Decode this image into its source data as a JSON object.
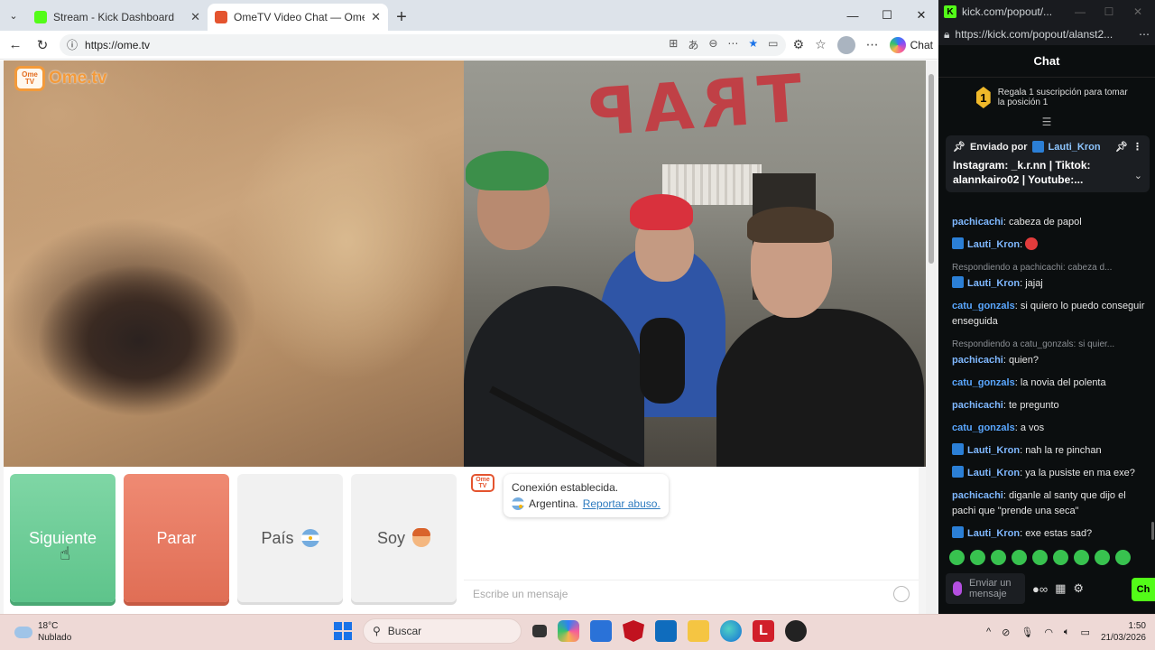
{
  "browser": {
    "tabs": [
      {
        "title": "Stream - Kick Dashboard",
        "icon": "kick-icon",
        "active": false
      },
      {
        "title": "OmeTV Video Chat — Omeg",
        "icon": "ometv-icon",
        "active": true
      }
    ],
    "url": "https://ome.tv",
    "copilot_label": "Chat"
  },
  "ometv": {
    "logo_text": "Ome.tv",
    "logo_badge": "Ome TV",
    "remote_graffiti": "TRAP",
    "buttons": {
      "next": "Siguiente",
      "stop": "Parar",
      "country": "País",
      "me": "Soy"
    },
    "system_message": {
      "line1": "Conexión establecida.",
      "country": "Argentina.",
      "report": "Reportar abuso."
    },
    "input_placeholder": "Escribe un mensaje"
  },
  "kick": {
    "window_title": "kick.com/popout/...",
    "url": "https://kick.com/popout/alanst2...",
    "header": "Chat",
    "gift": {
      "rank": "1",
      "text": "Regala 1 suscripción para tomar la posición 1"
    },
    "pinned": {
      "label": "Enviado por",
      "user": "Lauti_Kron",
      "text": "Instagram: _k.r.nn | Tiktok: alannkairo02 | Youtube:..."
    },
    "messages": [
      {
        "user": "pachicachi",
        "color": "#7fb8ff",
        "text": "cabeza de papol",
        "badge": false,
        "reply": ""
      },
      {
        "user": "Lauti_Kron",
        "color": "#7fb8ff",
        "text": "",
        "badge": true,
        "reply": "",
        "emote": true
      },
      {
        "user": "Lauti_Kron",
        "color": "#7fb8ff",
        "text": "jajaj",
        "badge": true,
        "reply": "Respondiendo a pachicachi: cabeza d..."
      },
      {
        "user": "catu_gonzals",
        "color": "#5aa7ff",
        "text": "si quiero lo puedo conseguir enseguida",
        "badge": false,
        "reply": ""
      },
      {
        "user": "pachicachi",
        "color": "#7fb8ff",
        "text": "quien?",
        "badge": false,
        "reply": "Respondiendo a catu_gonzals: si quier..."
      },
      {
        "user": "catu_gonzals",
        "color": "#5aa7ff",
        "text": "la novia del polenta",
        "badge": false,
        "reply": ""
      },
      {
        "user": "pachicachi",
        "color": "#7fb8ff",
        "text": "te pregunto",
        "badge": false,
        "reply": ""
      },
      {
        "user": "catu_gonzals",
        "color": "#5aa7ff",
        "text": "a vos",
        "badge": false,
        "reply": ""
      },
      {
        "user": "Lauti_Kron",
        "color": "#7fb8ff",
        "text": "nah la re pinchan",
        "badge": true,
        "reply": ""
      },
      {
        "user": "Lauti_Kron",
        "color": "#7fb8ff",
        "text": "ya la pusiste en ma exe?",
        "badge": true,
        "reply": ""
      },
      {
        "user": "pachicachi",
        "color": "#7fb8ff",
        "text": "diganle al santy que dijo el pachi que \"prende una seca\"",
        "badge": false,
        "reply": ""
      },
      {
        "user": "Lauti_Kron",
        "color": "#7fb8ff",
        "text": "exe estas sad?",
        "badge": true,
        "reply": ""
      }
    ],
    "input_placeholder": "Enviar un mensaje",
    "send_label": "Ch"
  },
  "taskbar": {
    "weather_temp": "18°C",
    "weather_desc": "Nublado",
    "search_label": "Buscar",
    "time": "1:50",
    "date": "21/03/2026"
  },
  "colors": {
    "ome_next": "#5ec48b",
    "ome_stop": "#e06e55",
    "kick_green": "#53fc18",
    "kick_bg": "#0b0e0f"
  }
}
